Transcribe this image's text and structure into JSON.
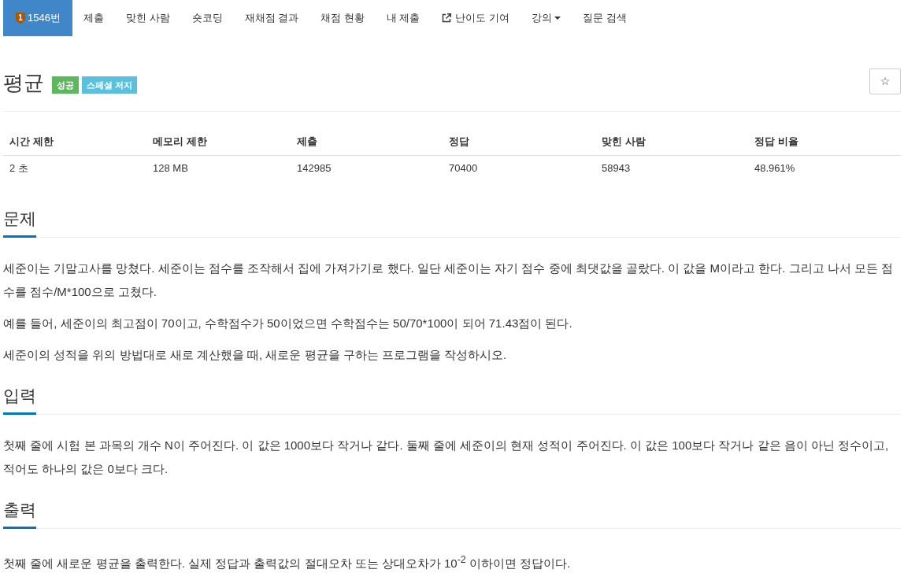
{
  "nav": {
    "items": [
      {
        "label": "1546번",
        "kind": "problem",
        "tier": "1",
        "selected": true
      },
      {
        "label": "제출",
        "kind": "link",
        "selected": false
      },
      {
        "label": "맞힌 사람",
        "kind": "link",
        "selected": false
      },
      {
        "label": "숏코딩",
        "kind": "link",
        "selected": false
      },
      {
        "label": "재채점 결과",
        "kind": "link",
        "selected": false
      },
      {
        "label": "채점 현황",
        "kind": "link",
        "selected": false
      },
      {
        "label": "내 제출",
        "kind": "link",
        "selected": false
      },
      {
        "label": "난이도 기여",
        "kind": "external",
        "selected": false
      },
      {
        "label": "강의",
        "kind": "dropdown",
        "selected": false
      },
      {
        "label": "질문 검색",
        "kind": "link",
        "selected": false
      }
    ]
  },
  "problem": {
    "title": "평균",
    "badges": [
      {
        "label": "성공",
        "color": "#5cb85c"
      },
      {
        "label": "스페셜 저지",
        "color": "#5bc0de"
      }
    ],
    "star_button": "☆"
  },
  "info_table": {
    "columns": [
      "시간 제한",
      "메모리 제한",
      "제출",
      "정답",
      "맞힌 사람",
      "정답 비율"
    ],
    "rows": [
      [
        "2 초",
        "128 MB",
        "142985",
        "70400",
        "58943",
        "48.961%"
      ]
    ]
  },
  "sections": [
    {
      "heading": "문제",
      "paragraphs": [
        "세준이는 기말고사를 망쳤다. 세준이는 점수를 조작해서 집에 가져가기로 했다. 일단 세준이는 자기 점수 중에 최댓값을 골랐다. 이 값을 M이라고 한다. 그리고 나서 모든 점수를 점수/M*100으로 고쳤다.",
        "예를 들어, 세준이의 최고점이 70이고, 수학점수가 50이었으면 수학점수는 50/70*100이 되어 71.43점이 된다.",
        "세준이의 성적을 위의 방법대로 새로 계산했을 때, 새로운 평균을 구하는 프로그램을 작성하시오."
      ]
    },
    {
      "heading": "입력",
      "paragraphs": [
        "첫째 줄에 시험 본 과목의 개수 N이 주어진다. 이 값은 1000보다 작거나 같다. 둘째 줄에 세준이의 현재 성적이 주어진다. 이 값은 100보다 작거나 같은 음이 아닌 정수이고, 적어도 하나의 값은 0보다 크다."
      ]
    },
    {
      "heading": "출력",
      "paragraphs": [
        "첫째 줄에 새로운 평균을 출력한다. 실제 정답과 출력값의 절대오차 또는 상대오차가 10$^{-2}$ 이하이면 정답이다."
      ]
    }
  ]
}
